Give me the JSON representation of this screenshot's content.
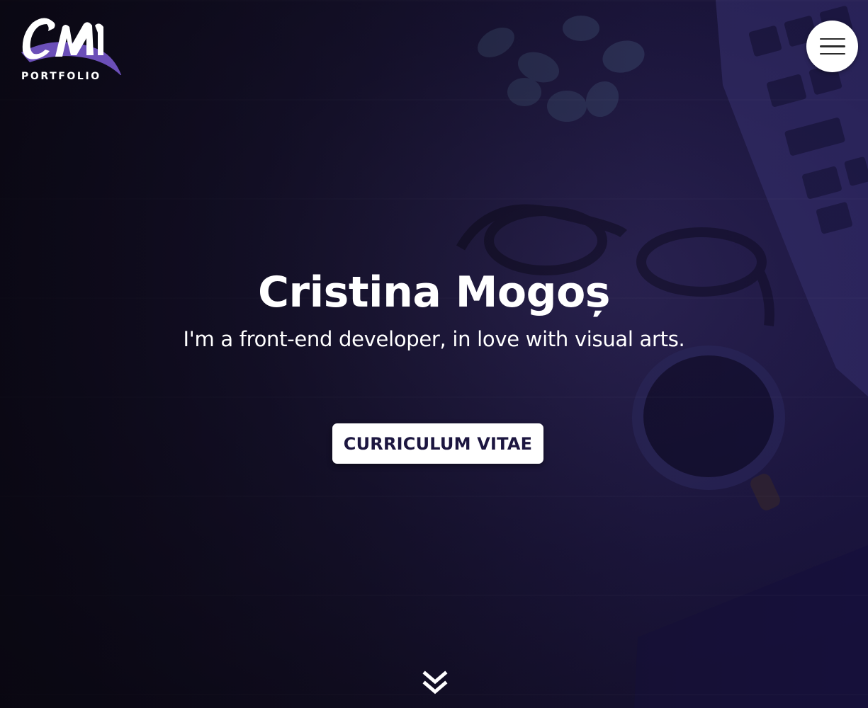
{
  "logo": {
    "monogram": "CM",
    "subtitle": "PORTFOLIO",
    "accent_color": "#6b4fb8"
  },
  "menu": {
    "icon": "hamburger-menu-icon"
  },
  "hero": {
    "name": "Cristina Mogoș",
    "tagline": "I'm a front-end developer, in love with visual arts.",
    "cta_label": "CURRICULUM VITAE",
    "cta_text_color": "#1c1640",
    "scroll_icon": "double-chevron-down-icon"
  },
  "colors": {
    "overlay": "#1a1536",
    "text": "#ffffff"
  }
}
